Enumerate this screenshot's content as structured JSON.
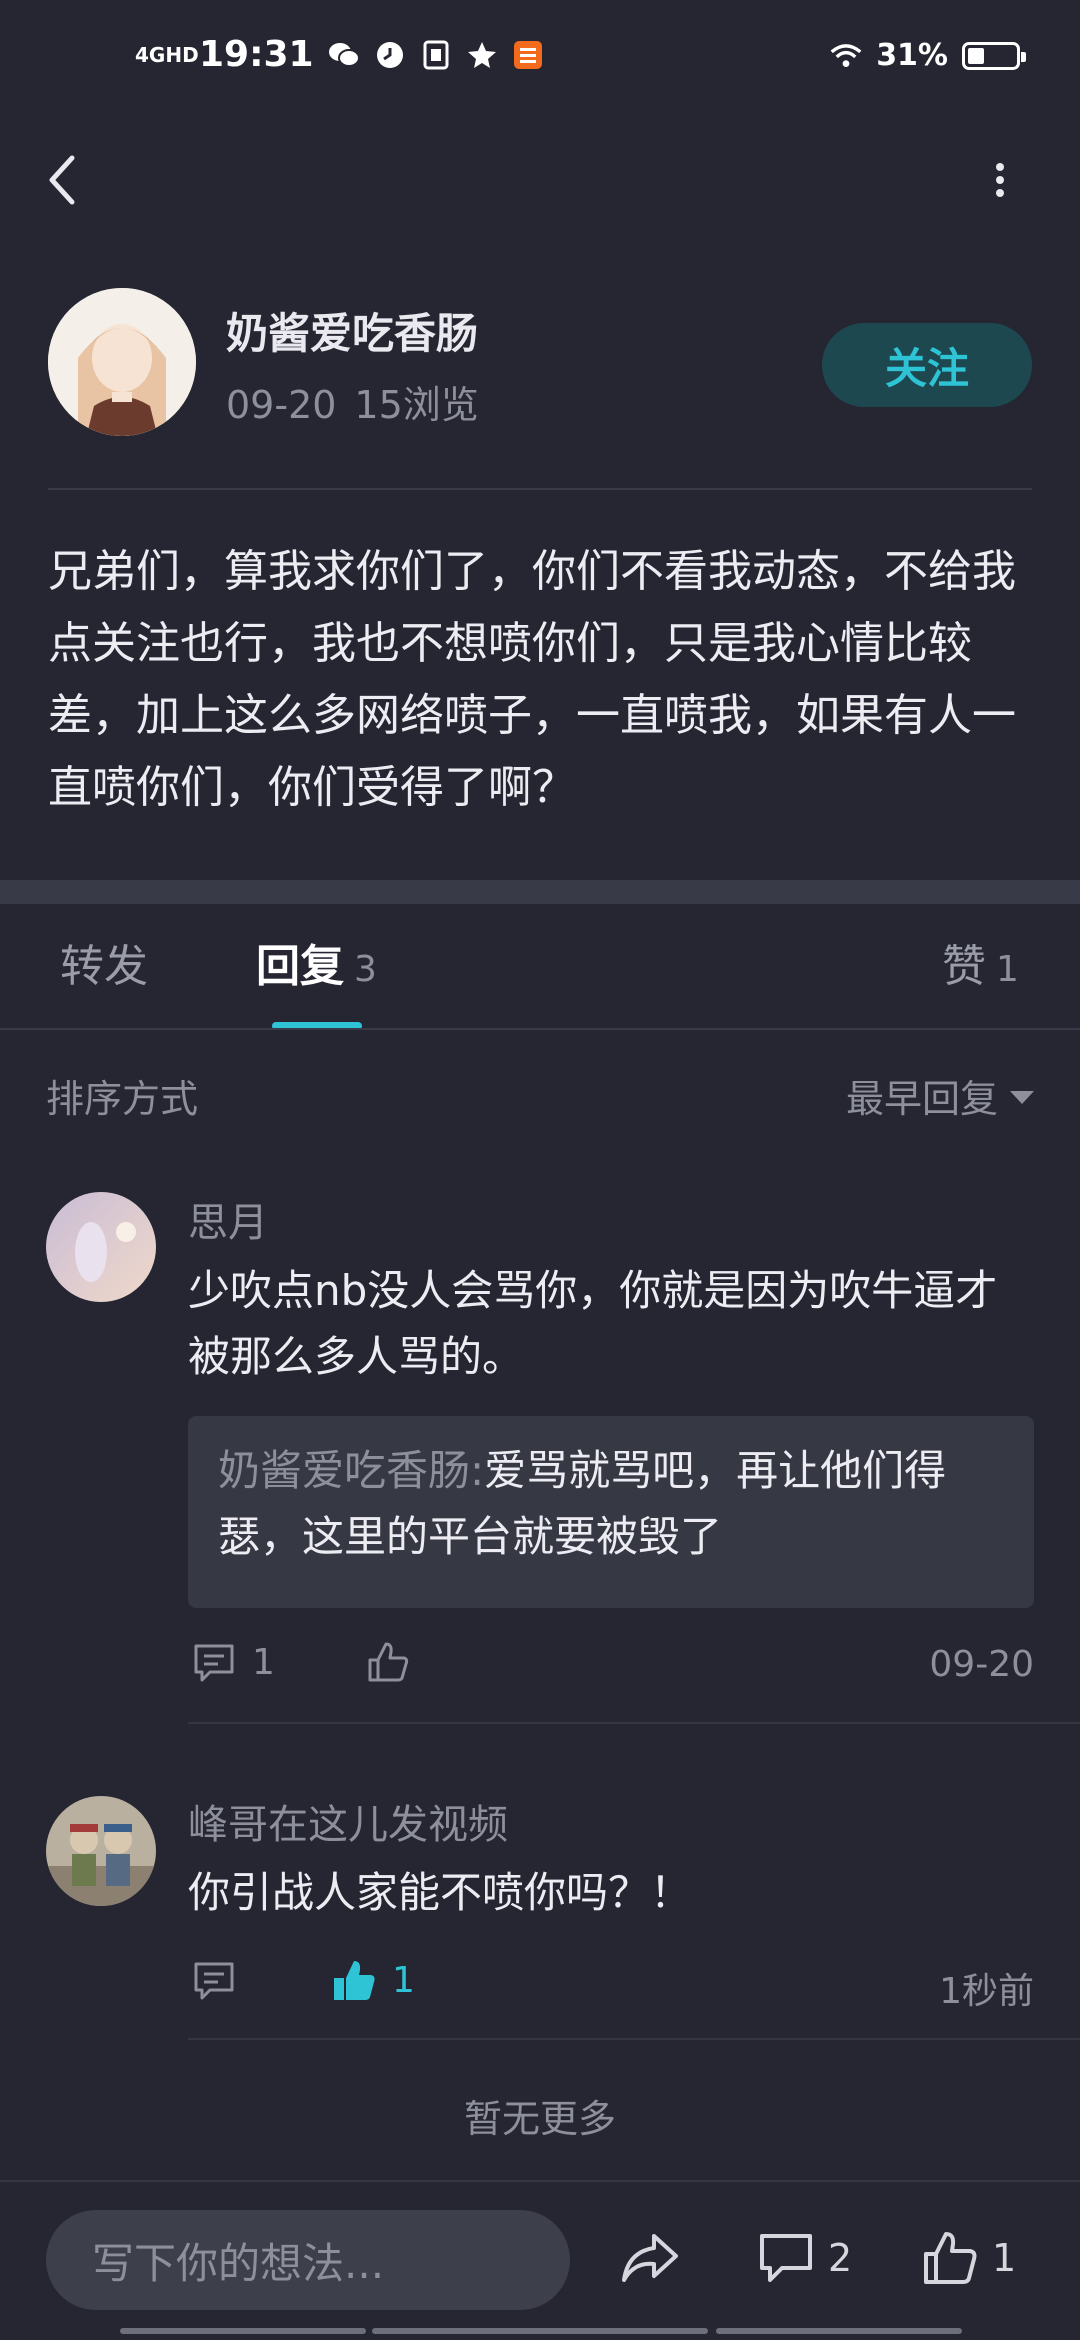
{
  "status_bar": {
    "network": "4GHD",
    "time": "19:31",
    "battery_percent": "31%",
    "battery_level": 0.31,
    "icons": [
      "signal-icon",
      "wechat-icon",
      "clock-icon",
      "sim-icon",
      "star-icon",
      "bank-app-icon",
      "wifi-icon",
      "battery-icon"
    ]
  },
  "post": {
    "author": "奶酱爱吃香肠",
    "date": "09-20",
    "views": "15浏览",
    "follow_label": "关注",
    "content": "兄弟们，算我求你们了，你们不看我动态，不给我点关注也行，我也不想喷你们，只是我心情比较差，加上这么多网络喷子，一直喷我，如果有人一直喷你们，你们受得了啊？"
  },
  "tabs": [
    {
      "label": "转发",
      "count": ""
    },
    {
      "label": "回复",
      "count": "3"
    },
    {
      "label": "赞",
      "count": "1"
    }
  ],
  "sort": {
    "label": "排序方式",
    "value": "最早回复"
  },
  "comments": [
    {
      "name": "思月",
      "text": "少吹点nb没人会骂你，你就是因为吹牛逼才被那么多人骂的。",
      "reply": {
        "author": "奶酱爱吃香肠",
        "separator": ":",
        "text": "爱骂就骂吧，再让他们得瑟，这里的平台就要被毁了"
      },
      "reply_count": "1",
      "like_count": "",
      "time": "09-20"
    },
    {
      "name": "峰哥在这儿发视频",
      "text": "你引战人家能不喷你吗？！",
      "reply_count": "",
      "like_count": "1",
      "liked": true,
      "time": "1秒前"
    }
  ],
  "no_more": "暂无更多",
  "bottom_bar": {
    "input_placeholder": "写下你的想法...",
    "comment_count": "2",
    "like_count": "1"
  },
  "colors": {
    "background": "#252631",
    "accent": "#2ec4d5",
    "follow_bg": "#1e4850",
    "muted_text": "#8d8f9b"
  }
}
